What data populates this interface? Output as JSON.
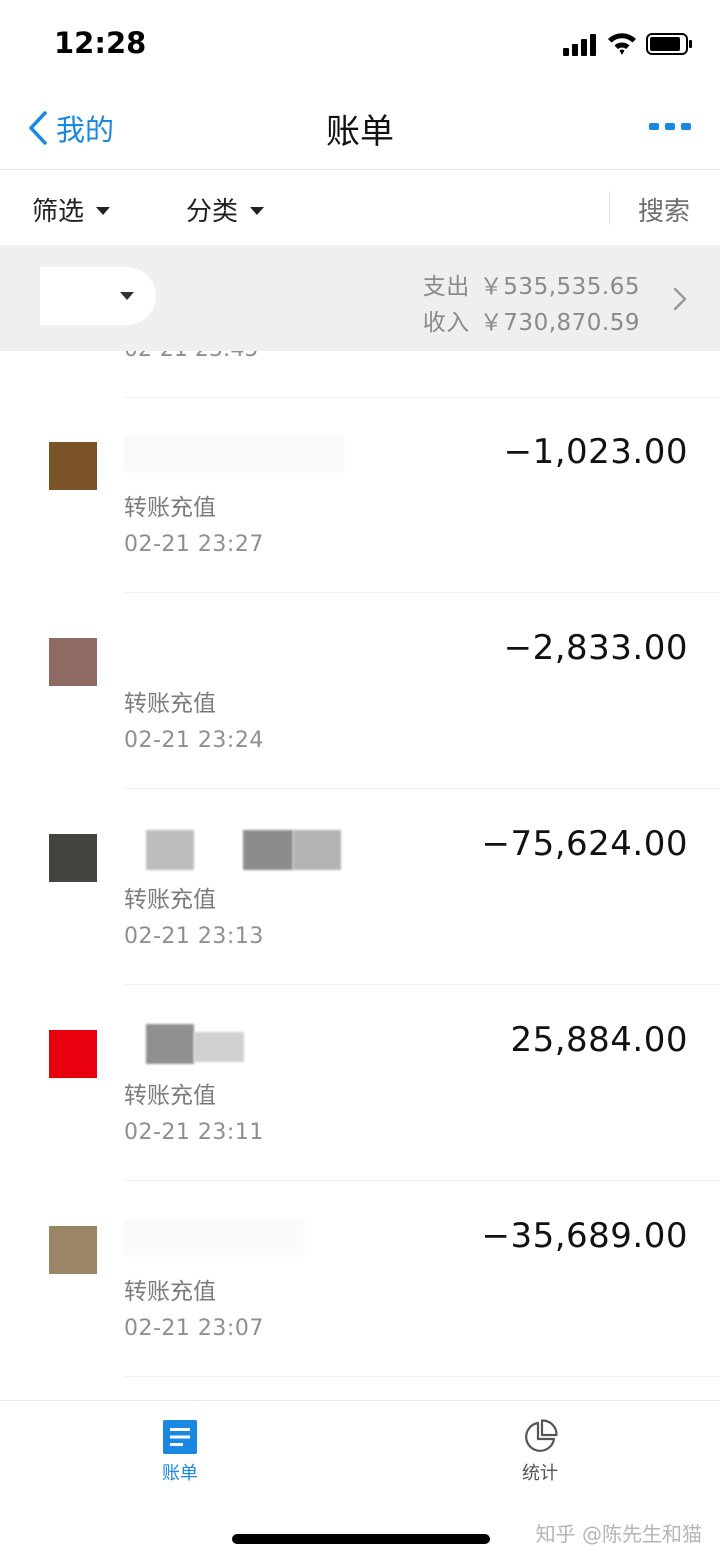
{
  "status_bar": {
    "time": "12:28"
  },
  "nav": {
    "back_label": "我的",
    "title": "账单"
  },
  "filters": {
    "filter_label": "筛选",
    "category_label": "分类",
    "search_label": "搜索"
  },
  "summary": {
    "expense_label": "支出",
    "expense_value": "￥535,535.65",
    "income_label": "收入",
    "income_value": "￥730,870.59"
  },
  "partial_row": {
    "time": "02-21  23:45"
  },
  "transactions": [
    {
      "amount": "−1,023.00",
      "category": "转账充值",
      "time": "02-21  23:27",
      "avatar_color": "#7a5427"
    },
    {
      "amount": "−2,833.00",
      "category": "转账充值",
      "time": "02-21  23:24",
      "avatar_color": "#8d6b62"
    },
    {
      "amount": "−75,624.00",
      "category": "转账充值",
      "time": "02-21  23:13",
      "avatar_color": "#43433f"
    },
    {
      "amount": "25,884.00",
      "category": "转账充值",
      "time": "02-21  23:11",
      "avatar_color": "#e8000f"
    },
    {
      "amount": "−35,689.00",
      "category": "转账充值",
      "time": "02-21  23:07",
      "avatar_color": "#9c8467"
    }
  ],
  "tab_bar": {
    "tabs": [
      {
        "label": "账单",
        "icon": "bill-list-icon",
        "active": true
      },
      {
        "label": "统计",
        "icon": "pie-chart-icon",
        "active": false
      }
    ],
    "watermark": "知乎 @陈先生和猫"
  },
  "colors": {
    "accent": "#1a88e0",
    "summary_bg": "#efefef"
  }
}
